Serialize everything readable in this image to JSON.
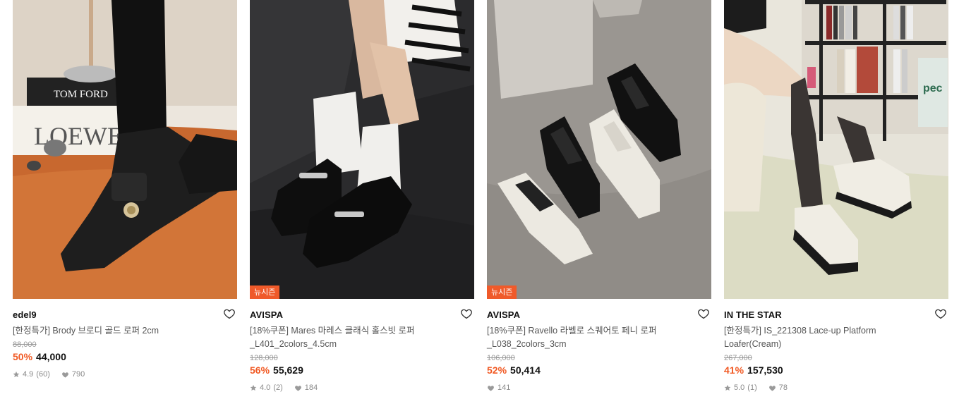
{
  "products": [
    {
      "brand": "edel9",
      "title": "[한정특가] Brody 브로디 골드 로퍼 2cm",
      "original_price": "88,000",
      "discount": "50%",
      "price": "44,000",
      "rating": "4.9",
      "reviews": "(60)",
      "likes": "790",
      "badge": ""
    },
    {
      "brand": "AVISPA",
      "title": "[18%쿠폰] Mares 마레스 클래식 홀스빗 로퍼 _L401_2colors_4.5cm",
      "original_price": "128,000",
      "discount": "56%",
      "price": "55,629",
      "rating": "4.0",
      "reviews": "(2)",
      "likes": "184",
      "badge": "뉴시즌"
    },
    {
      "brand": "AVISPA",
      "title": "[18%쿠폰] Ravello 라벨로 스퀘어토 페니 로퍼 _L038_2colors_3cm",
      "original_price": "106,000",
      "discount": "52%",
      "price": "50,414",
      "rating": "",
      "reviews": "",
      "likes": "141",
      "badge": "뉴시즌"
    },
    {
      "brand": "IN THE STAR",
      "title": "[한정특가] IS_221308 Lace-up Platform Loafer(Cream)",
      "original_price": "267,000",
      "discount": "41%",
      "price": "157,530",
      "rating": "5.0",
      "reviews": "(1)",
      "likes": "78",
      "badge": ""
    }
  ],
  "image_text": {
    "book_top": "TOM FORD",
    "book_bottom": "LOEWE",
    "magazine": "pec"
  },
  "colors": {
    "accent": "#f15a24",
    "badge_bg": "#ef5a2a",
    "muted": "#8a8a8a"
  },
  "icons": {
    "wishlist": "heart-outline-icon",
    "rating": "star-icon",
    "likes": "heart-filled-icon"
  }
}
